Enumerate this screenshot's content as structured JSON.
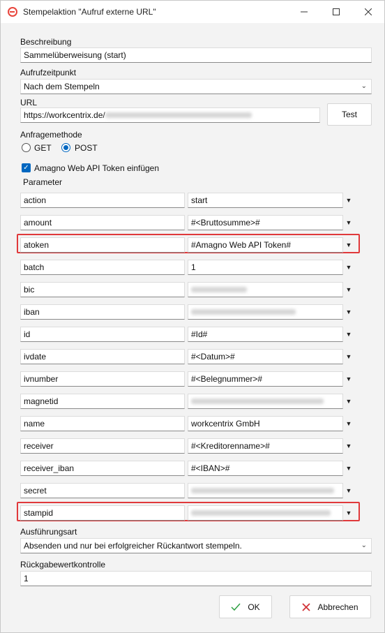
{
  "window": {
    "title": "Stempelaktion \"Aufruf externe URL\"",
    "minimize_icon": "minimize-icon",
    "maximize_icon": "maximize-icon",
    "close_icon": "close-icon"
  },
  "beschreibung": {
    "label": "Beschreibung",
    "value": "Sammelüberweisung (start)"
  },
  "aufrufzeitpunkt": {
    "label": "Aufrufzeitpunkt",
    "value": "Nach dem Stempeln"
  },
  "url": {
    "label": "URL",
    "value": "https://workcentrix.de/",
    "test_label": "Test"
  },
  "anfragemethode": {
    "label": "Anfragemethode",
    "get": "GET",
    "post": "POST",
    "selected": "POST"
  },
  "token": {
    "label": "Amagno Web API Token einfügen",
    "checked": true
  },
  "parameter": {
    "label": "Parameter",
    "rows": [
      {
        "name": "action",
        "value": "start"
      },
      {
        "name": "amount",
        "value": "#<Bruttosumme>#"
      },
      {
        "name": "atoken",
        "value": "#Amagno Web API Token#"
      },
      {
        "name": "batch",
        "value": "1"
      },
      {
        "name": "bic",
        "value": ""
      },
      {
        "name": "iban",
        "value": ""
      },
      {
        "name": "id",
        "value": "#Id#"
      },
      {
        "name": "ivdate",
        "value": "#<Datum>#"
      },
      {
        "name": "ivnumber",
        "value": "#<Belegnummer>#"
      },
      {
        "name": "magnetid",
        "value": ""
      },
      {
        "name": "name",
        "value": "workcentrix GmbH"
      },
      {
        "name": "receiver",
        "value": "#<Kreditorenname>#"
      },
      {
        "name": "receiver_iban",
        "value": "#<IBAN>#"
      },
      {
        "name": "secret",
        "value": ""
      },
      {
        "name": "stampid",
        "value": ""
      }
    ]
  },
  "ausfuehrungsart": {
    "label": "Ausführungsart",
    "value": "Absenden und nur bei erfolgreicher Rückantwort stempeln."
  },
  "rueckgabe": {
    "label": "Rückgabewertkontrolle",
    "value": "1"
  },
  "buttons": {
    "ok": "OK",
    "cancel": "Abbrechen"
  },
  "colors": {
    "accent": "#0067c0",
    "highlight": "#e0393b",
    "ok_check": "#2ea043",
    "cancel_x": "#d13438",
    "app_icon": "#e8453c"
  }
}
